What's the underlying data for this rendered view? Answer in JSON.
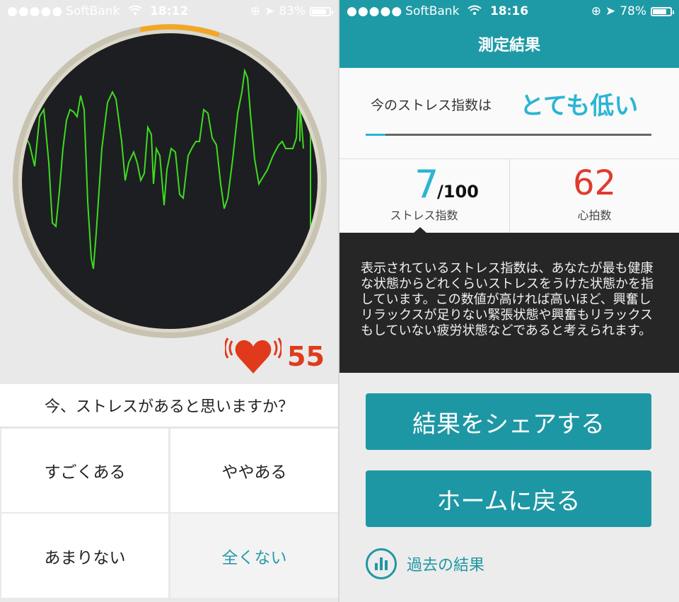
{
  "left": {
    "status": {
      "carrier": "SoftBank",
      "time": "18:12",
      "battery": "83%",
      "battery_level": 0.83
    },
    "measurement_progress": 0.13,
    "heart_rate": "55",
    "question": "今、ストレスがあると思いますか？",
    "options": [
      "すごくある",
      "ややある",
      "あまりない",
      "全くない"
    ]
  },
  "right": {
    "status": {
      "carrier": "SoftBank",
      "time": "18:16",
      "battery": "78%",
      "battery_level": 0.78
    },
    "header_title": "測定結果",
    "level_label": "今のストレス指数は",
    "level_value": "とても低い",
    "stress_index": {
      "value": "7",
      "max": "/100",
      "label": "ストレス指数",
      "fraction": 0.07
    },
    "heart_rate": {
      "value": "62",
      "label": "心拍数"
    },
    "explanation": "表示されているストレス指数は、あなたが最も健康な状態からどれくらいストレスをうけた状態かを指しています。この数値が高ければ高いほど、興奮しリラックスが足りない緊張状態や興奮もリラックスもしていない疲労状態などであると考えられます。",
    "share_button": "結果をシェアする",
    "home_button": "ホームに戻る",
    "history_link": "過去の結果"
  },
  "colors": {
    "teal": "#1e97a4",
    "cyan": "#2bb5d3",
    "red": "#e13a2d",
    "waveform": "#3ddc1e",
    "progress": "#f5a623"
  },
  "icons": [
    "wifi-icon",
    "location-icon",
    "rotation-lock-icon",
    "battery-icon",
    "heart-icon",
    "bar-chart-icon"
  ]
}
